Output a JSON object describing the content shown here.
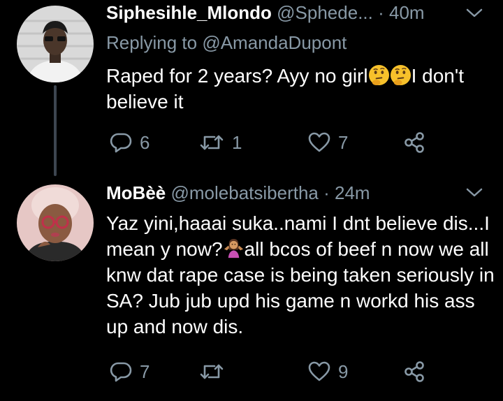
{
  "colors": {
    "background": "#000000",
    "text": "#ffffff",
    "secondary": "#8899a6",
    "thread_line": "#3d4650"
  },
  "tweets": [
    {
      "name": "Siphesihle_Mlondo",
      "handle": "@Sphede...",
      "time": "· 40m",
      "replying_label": "Replying to",
      "replying_handle": "@AmandaDupont",
      "text_part1": "Raped for 2 years? Ayy no girl",
      "text_part2": "I don't believe it",
      "emoji": "thinking-face",
      "reply_count": "6",
      "retweet_count": "1",
      "like_count": "7"
    },
    {
      "name": "MoBèè",
      "handle": "@molebatsibertha",
      "time": "· 24m",
      "text_part1": "Yaz yini,haaai suka..nami I dnt believe dis...I mean y now?",
      "text_part2": "all bcos of beef n now we all knw dat rape case is being taken seriously in SA? Jub jub upd his game n workd his ass up and now dis.",
      "emoji": "woman-shrugging",
      "reply_count": "7",
      "retweet_count": "",
      "like_count": "9"
    }
  ]
}
